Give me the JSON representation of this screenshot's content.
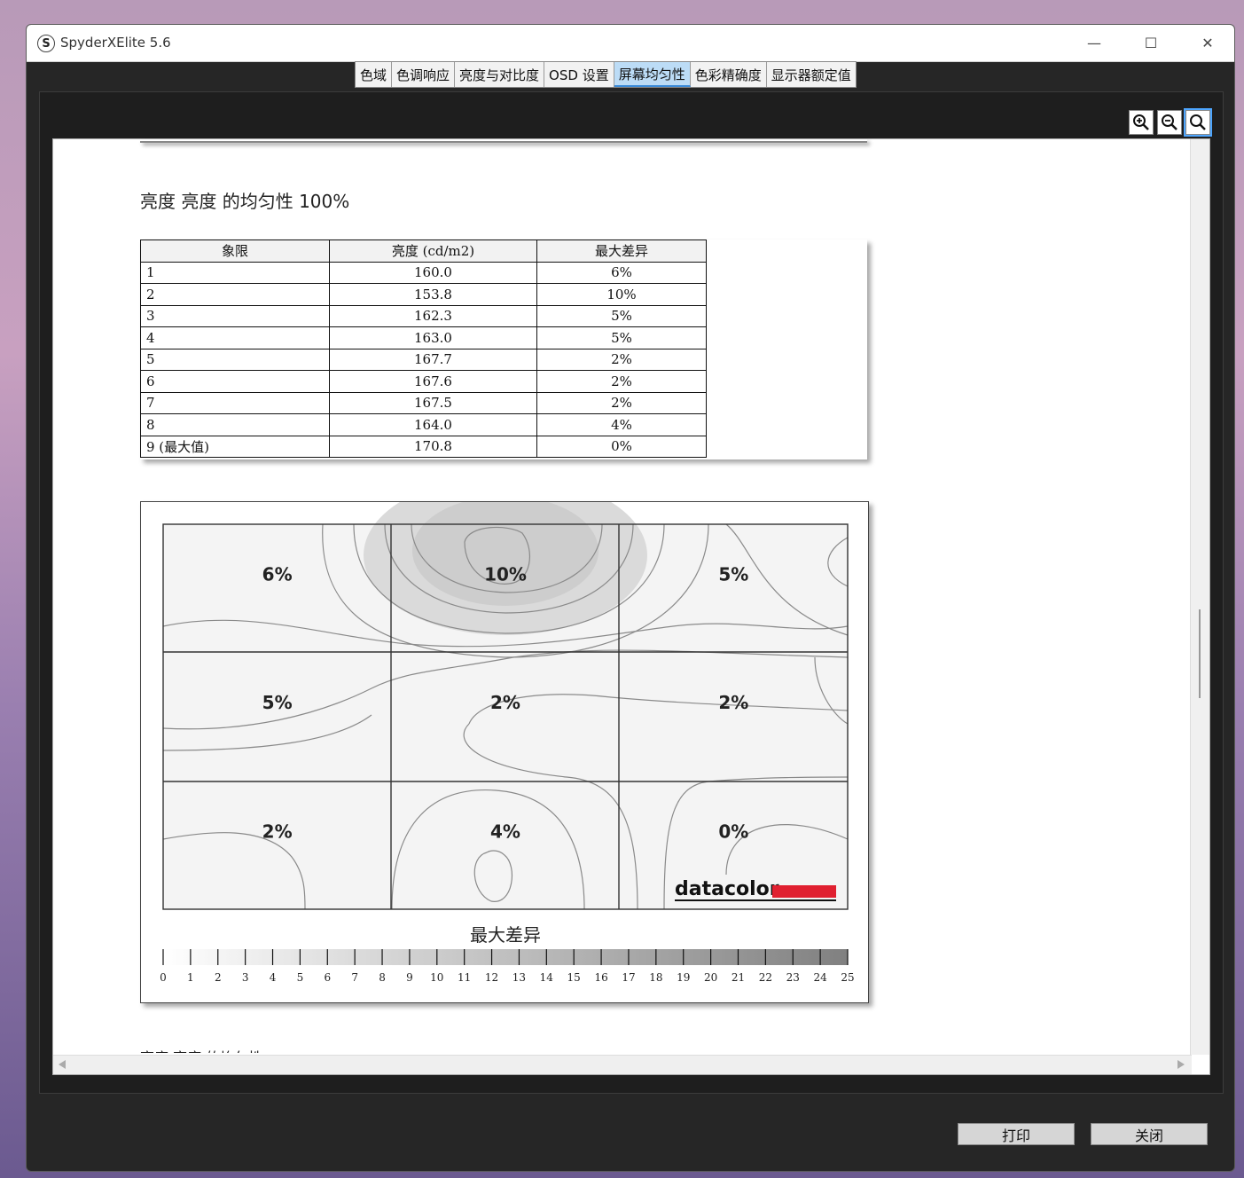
{
  "window": {
    "title": "SpyderXElite 5.6",
    "minimize_glyph": "—",
    "maximize_glyph": "☐",
    "close_glyph": "✕"
  },
  "tabs": [
    {
      "label": "色域",
      "active": false
    },
    {
      "label": "色调响应",
      "active": false
    },
    {
      "label": "亮度与对比度",
      "active": false
    },
    {
      "label": "OSD 设置",
      "active": false
    },
    {
      "label": "屏幕均匀性",
      "active": true
    },
    {
      "label": "色彩精确度",
      "active": false
    },
    {
      "label": "显示器额定值",
      "active": false
    }
  ],
  "zoom": {
    "icons": [
      "zoom-in-icon",
      "zoom-out-icon",
      "zoom-fit-icon"
    ],
    "active": "zoom-fit-icon"
  },
  "report": {
    "section_title": "亮度 亮度 的均匀性 100%",
    "table": {
      "headers": [
        "象限",
        "亮度 (cd/m2)",
        "最大差异"
      ],
      "rows": [
        [
          "1",
          "160.0",
          "6%"
        ],
        [
          "2",
          "153.8",
          "10%"
        ],
        [
          "3",
          "162.3",
          "5%"
        ],
        [
          "4",
          "163.0",
          "5%"
        ],
        [
          "5",
          "167.7",
          "2%"
        ],
        [
          "6",
          "167.6",
          "2%"
        ],
        [
          "7",
          "167.5",
          "2%"
        ],
        [
          "8",
          "164.0",
          "4%"
        ],
        [
          "9 (最大值)",
          "170.8",
          "0%"
        ]
      ]
    },
    "chart_data": {
      "type": "heatmap",
      "title": "",
      "grid": {
        "rows": 3,
        "cols": 3
      },
      "cells": [
        [
          "6%",
          "10%",
          "5%"
        ],
        [
          "5%",
          "2%",
          "2%"
        ],
        [
          "2%",
          "4%",
          "0%"
        ]
      ],
      "values": [
        [
          6,
          10,
          5
        ],
        [
          5,
          2,
          2
        ],
        [
          2,
          4,
          0
        ]
      ],
      "legend": {
        "label": "最大差异",
        "ticks": [
          0,
          1,
          2,
          3,
          4,
          5,
          6,
          7,
          8,
          9,
          10,
          11,
          12,
          13,
          14,
          15,
          16,
          17,
          18,
          19,
          20,
          21,
          22,
          23,
          24,
          25
        ],
        "range": [
          0,
          25
        ]
      },
      "brand": "datacolor",
      "colors": {
        "brand_bar": "#e02030",
        "low": "#ffffff",
        "high": "#808080"
      }
    },
    "next_section_fragment": "亮度 亮度 的均匀性"
  },
  "footer": {
    "print_label": "打印",
    "close_label": "关闭"
  }
}
